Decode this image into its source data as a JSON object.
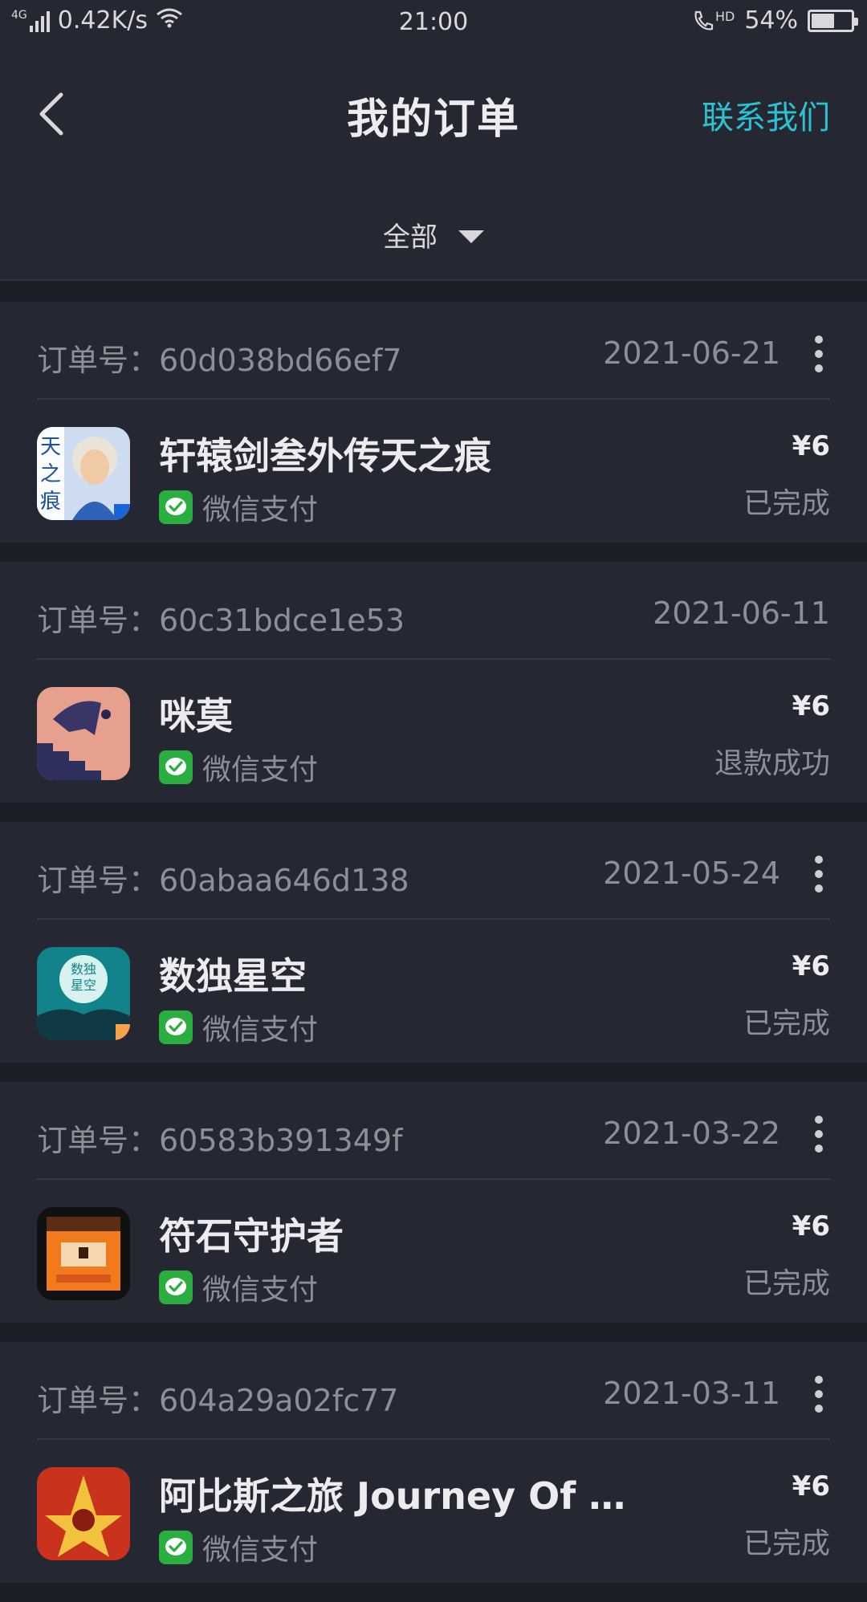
{
  "status_bar": {
    "network": "4G",
    "speed": "0.42K/s",
    "time": "21:00",
    "hd": "HD",
    "battery": "54%"
  },
  "header": {
    "title": "我的订单",
    "contact_label": "联系我们",
    "filter_label": "全部"
  },
  "orders": [
    {
      "order_no": "订单号：60d038bd66ef7",
      "date": "2021-06-21",
      "app_name": "轩辕剑叁外传天之痕",
      "payment": "微信支付",
      "price": "¥6",
      "status": "已完成",
      "icon": "app-icon-xuanyuan",
      "icon_text": "天之痕"
    },
    {
      "order_no": "订单号：60c31bdce1e53",
      "date": "2021-06-11",
      "app_name": "咪莫",
      "payment": "微信支付",
      "price": "¥6",
      "status": "退款成功",
      "icon": "app-icon-mimo"
    },
    {
      "order_no": "订单号：60abaa646d138",
      "date": "2021-05-24",
      "app_name": "数独星空",
      "payment": "微信支付",
      "price": "¥6",
      "status": "已完成",
      "icon": "app-icon-sudoku",
      "icon_text": "数独星空"
    },
    {
      "order_no": "订单号：60583b391349f",
      "date": "2021-03-22",
      "app_name": "符石守护者",
      "payment": "微信支付",
      "price": "¥6",
      "status": "已完成",
      "icon": "app-icon-runestone"
    },
    {
      "order_no": "订单号：604a29a02fc77",
      "date": "2021-03-11",
      "app_name": "阿比斯之旅 Journey Of A...",
      "payment": "微信支付",
      "price": "¥6",
      "status": "已完成",
      "icon": "app-icon-abyss"
    }
  ],
  "colors": {
    "accent": "#2bc3d1",
    "background": "#1c1e27",
    "card": "#252733",
    "wechat": "#2aae3f"
  }
}
